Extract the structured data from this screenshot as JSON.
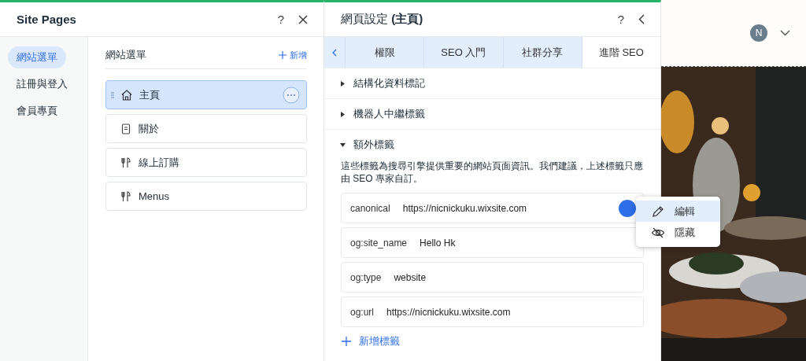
{
  "site_pages": {
    "title": "Site Pages",
    "help": "?",
    "sidebar": [
      {
        "label": "網站選單",
        "selected": true
      },
      {
        "label": "註冊與登入",
        "selected": false
      },
      {
        "label": "會員專頁",
        "selected": false
      }
    ],
    "list_title": "網站選單",
    "add_label": "新增",
    "pages": [
      {
        "label": "主頁",
        "kind": "home",
        "selected": true
      },
      {
        "label": "關於",
        "kind": "page",
        "selected": false
      },
      {
        "label": "線上訂購",
        "kind": "menu",
        "selected": false
      },
      {
        "label": "Menus",
        "kind": "menu",
        "selected": false
      }
    ]
  },
  "page_settings": {
    "title": "網頁設定 **(主頁)**",
    "help": "?",
    "tabs": [
      {
        "label": "權限",
        "selected": false
      },
      {
        "label": "SEO 入門",
        "selected": false
      },
      {
        "label": "社群分享",
        "selected": false
      },
      {
        "label": "進階 SEO",
        "selected": true
      }
    ],
    "sections": [
      {
        "title": "結構化資料標記",
        "expanded": false
      },
      {
        "title": "機器人中繼標籤",
        "expanded": false
      },
      {
        "title": "額外標籤",
        "expanded": true
      }
    ],
    "description": "這些標籤為搜尋引擎提供重要的網站頁面資訊。我們建議，上述標籤只應由 SEO 專家自訂。",
    "tags": [
      {
        "name": "canonical",
        "value": "https://nicnickuku.wixsite.com"
      },
      {
        "name": "og:site_name",
        "value": "Hello Hk"
      },
      {
        "name": "og:type",
        "value": "website"
      },
      {
        "name": "og:url",
        "value": "https://nicnickuku.wixsite.com"
      }
    ],
    "add_tag": "新增標籤",
    "menu": [
      {
        "label": "編輯",
        "kind": "edit",
        "selected": true
      },
      {
        "label": "隱藏",
        "kind": "hide",
        "selected": false
      }
    ]
  },
  "preview": {
    "avatar": "N"
  }
}
